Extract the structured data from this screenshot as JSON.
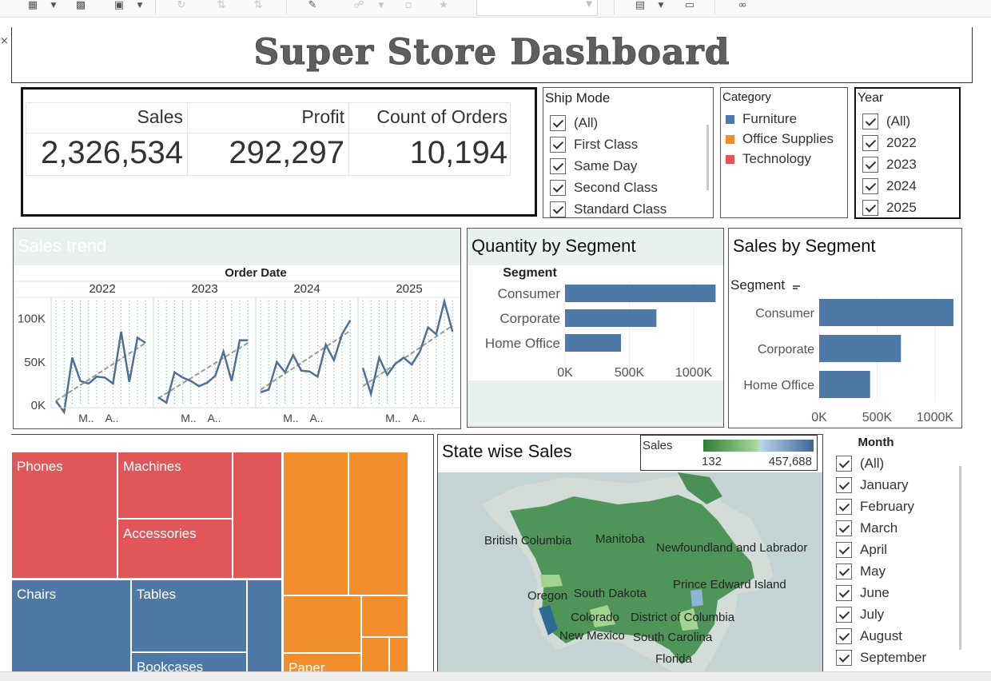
{
  "dashboard": {
    "title": "Super Store Dashboard"
  },
  "kpis": [
    {
      "label": "Sales",
      "value": "2,326,534"
    },
    {
      "label": "Profit",
      "value": "292,297"
    },
    {
      "label": "Count of Orders",
      "value": "10,194"
    }
  ],
  "ship_mode_filter": {
    "title": "Ship Mode",
    "options": [
      "(All)",
      "First Class",
      "Same Day",
      "Second Class",
      "Standard Class"
    ]
  },
  "category_legend": {
    "title": "Category",
    "items": [
      {
        "label": "Furniture",
        "color": "#4e79a7"
      },
      {
        "label": "Office Supplies",
        "color": "#f28e2b"
      },
      {
        "label": "Technology",
        "color": "#e15759"
      }
    ]
  },
  "year_filter": {
    "title": "Year",
    "options": [
      "(All)",
      "2022",
      "2023",
      "2024",
      "2025"
    ]
  },
  "month_filter": {
    "title": "Month",
    "options": [
      "(All)",
      "January",
      "February",
      "March",
      "April",
      "May",
      "June",
      "July",
      "August",
      "September"
    ]
  },
  "sales_trend": {
    "title": "Sales trend",
    "header": "Order Date",
    "years": [
      "2022",
      "2023",
      "2024",
      "2025"
    ],
    "month_ticks": [
      "M..",
      "A.."
    ],
    "y_ticks": [
      "100K",
      "50K",
      "0K"
    ],
    "chart_data": {
      "type": "line",
      "ylim": [
        0,
        120000
      ],
      "series": [
        {
          "values": [
            5000,
            -8000,
            55000,
            28000,
            25000,
            33000,
            32000,
            25000,
            85000,
            27000,
            78000,
            72000
          ]
        },
        {
          "values": [
            9000,
            3000,
            38000,
            32000,
            28000,
            22000,
            26000,
            34000,
            62000,
            28000,
            75000,
            75000
          ]
        },
        {
          "values": [
            15000,
            18000,
            50000,
            38000,
            58000,
            40000,
            39000,
            33000,
            70000,
            52000,
            82000,
            98000
          ]
        },
        {
          "values": [
            43000,
            13000,
            55000,
            35000,
            48000,
            55000,
            47000,
            62000,
            90000,
            82000,
            120000,
            85000
          ]
        }
      ],
      "trend_lines": [
        [
          5000,
          72000
        ],
        [
          8000,
          72000
        ],
        [
          18000,
          86000
        ],
        [
          22000,
          92000
        ]
      ]
    }
  },
  "quantity_by_segment": {
    "title": "Quantity by Segment",
    "axis_label": "Segment",
    "chart_data": {
      "type": "bar",
      "categories": [
        "Consumer",
        "Corporate",
        "Home Office"
      ],
      "values": [
        1170000,
        710000,
        435000
      ],
      "ticks": [
        "0K",
        "500K",
        "1000K"
      ],
      "xlim": [
        0,
        1180000
      ]
    }
  },
  "sales_by_segment": {
    "title": "Sales by Segment",
    "axis_label": "Segment",
    "chart_data": {
      "type": "bar",
      "categories": [
        "Consumer",
        "Corporate",
        "Home Office"
      ],
      "values": [
        1160000,
        706000,
        440000
      ],
      "ticks": [
        "0K",
        "500K",
        "1000K"
      ],
      "xlim": [
        0,
        1180000
      ]
    }
  },
  "treemap": {
    "labels": {
      "phones": "Phones",
      "machines": "Machines",
      "accessories": "Accessories",
      "chairs": "Chairs",
      "tables": "Tables",
      "bookcases": "Bookcases",
      "paper": "Paper"
    }
  },
  "map": {
    "title": "State wise Sales",
    "legend_title": "Sales",
    "legend_min": "132",
    "legend_max": "457,688",
    "places": [
      "British Columbia",
      "Manitoba",
      "Newfoundland and Labrador",
      "Oregon",
      "South Dakota",
      "Prince Edward Island",
      "Colorado",
      "District of Columbia",
      "New Mexico",
      "South Carolina",
      "Florida"
    ]
  }
}
